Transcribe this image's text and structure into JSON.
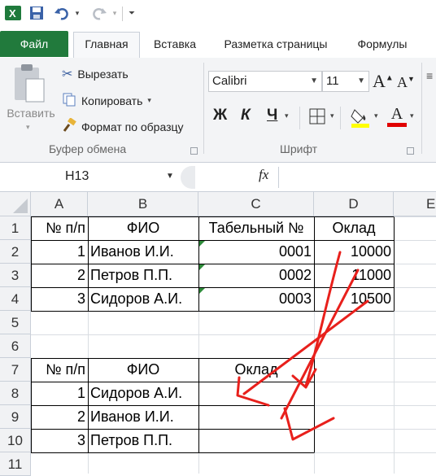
{
  "quick_access": {
    "excel_icon": "excel-icon",
    "save_icon": "save-icon",
    "undo_icon": "undo-icon",
    "redo_icon": "redo-icon",
    "customize_icon": "customize-icon"
  },
  "tabs": [
    "Файл",
    "Главная",
    "Вставка",
    "Разметка страницы",
    "Формулы"
  ],
  "clipboard": {
    "paste": "Вставить",
    "cut": "Вырезать",
    "copy": "Копировать",
    "format_painter": "Формат по образцу",
    "group": "Буфер обмена"
  },
  "font": {
    "name": "Calibri",
    "size": "11",
    "bold": "Ж",
    "italic": "К",
    "underline": "Ч",
    "group": "Шрифт",
    "fill_color": "#ffff00",
    "font_color": "#e00000"
  },
  "formula_bar": {
    "name_box": "H13",
    "fx": "fx",
    "value": ""
  },
  "columns": [
    "A",
    "B",
    "C",
    "D",
    "E"
  ],
  "rows": [
    "1",
    "2",
    "3",
    "4",
    "5",
    "6",
    "7",
    "8",
    "9",
    "10",
    "11"
  ],
  "cells": {
    "A1": "№ п/п",
    "B1": "ФИО",
    "C1": "Табельный №",
    "D1": "Оклад",
    "A2": "1",
    "B2": "Иванов И.И.",
    "C2": "0001",
    "D2": "10000",
    "A3": "2",
    "B3": "Петров П.П.",
    "C3": "0002",
    "D3": "11000",
    "A4": "3",
    "B4": "Сидоров А.И.",
    "C4": "0003",
    "D4": "10500",
    "A7": "№ п/п",
    "B7": "ФИО",
    "C7": "Оклад",
    "A8": "1",
    "B8": "Сидоров А.И.",
    "A9": "2",
    "B9": "Иванов И.И.",
    "A10": "3",
    "B10": "Петров П.П."
  },
  "annotation_color": "#e8201c"
}
